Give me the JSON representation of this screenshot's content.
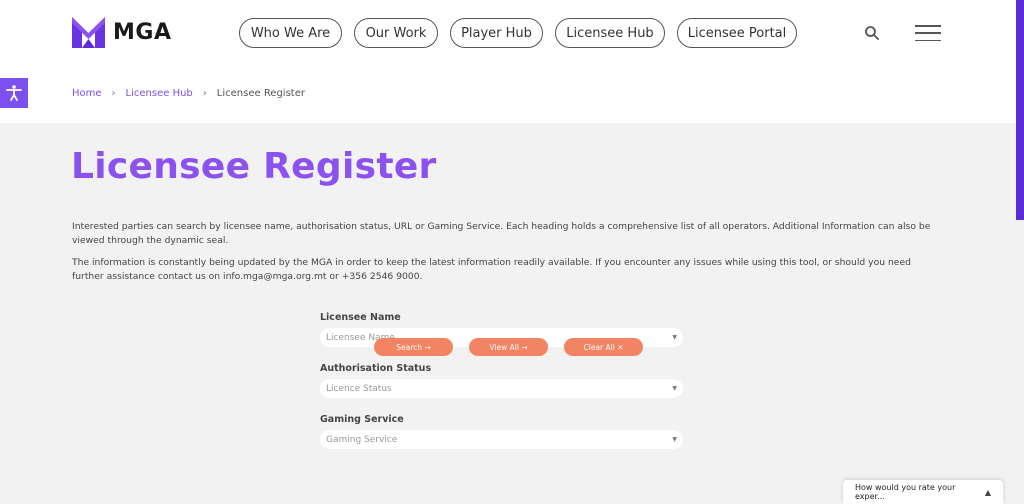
{
  "header": {
    "logo_text": "MGA",
    "nav": [
      {
        "label": "Who We Are"
      },
      {
        "label": "Our Work"
      },
      {
        "label": "Player Hub"
      },
      {
        "label": "Licensee Hub"
      },
      {
        "label": "Licensee Portal"
      }
    ]
  },
  "breadcrumb": {
    "items": [
      "Home",
      "Licensee Hub",
      "Licensee Register"
    ],
    "separator": "›"
  },
  "main": {
    "title": "Licensee Register",
    "intro": [
      "Interested parties can search by licensee name, authorisation status, URL or Gaming Service. Each heading holds a comprehensive list of all operators. Additional Information can also be viewed through the dynamic seal.",
      "The information is constantly being updated by the MGA in order to keep the latest information readily available. If you encounter any issues while using this tool, or should you need further assistance contact us on info.mga@mga.org.mt or +356 2546 9000."
    ],
    "form": {
      "fields": [
        {
          "label": "Licensee Name",
          "placeholder": "Licensee Name"
        },
        {
          "label": "Authorisation Status",
          "placeholder": "Licence Status"
        },
        {
          "label": "Gaming Service",
          "placeholder": "Gaming Service"
        }
      ],
      "buttons": {
        "search": "Search →",
        "view_all": "View All →",
        "clear_all": "Clear All ✕"
      }
    }
  },
  "feedback": {
    "label": "How would you rate your exper..."
  },
  "icons": {
    "search": "search-icon",
    "menu": "hamburger-menu-icon",
    "accessibility": "accessibility-icon",
    "caret": "caret-down-icon",
    "feedback_toggle": "triangle-up-icon"
  },
  "colors": {
    "brand_purple": "#8b52f0",
    "accent_purple": "#7b4ff0",
    "button_coral": "#f28363",
    "main_bg": "#f2f2f2"
  }
}
